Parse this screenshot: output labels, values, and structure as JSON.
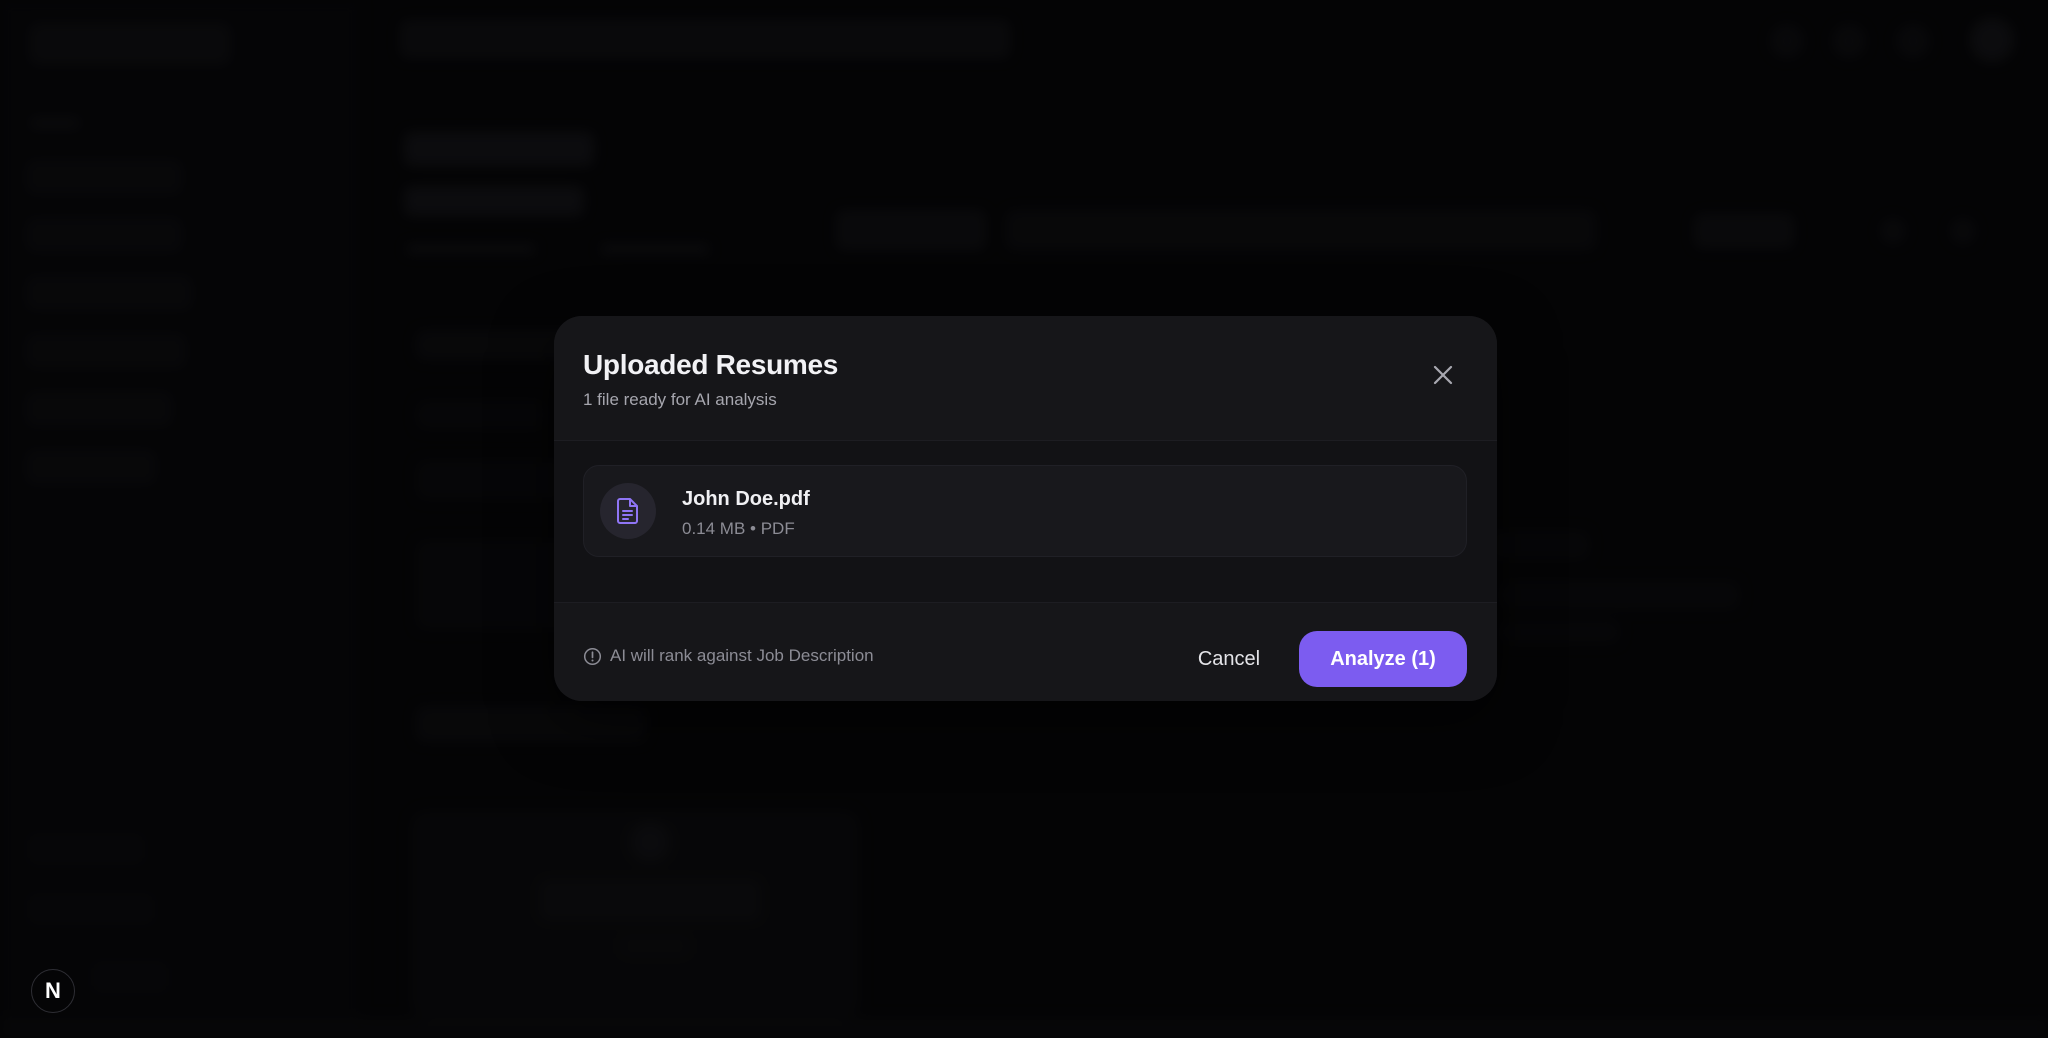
{
  "modal": {
    "title": "Uploaded Resumes",
    "subtitle": "1 file ready for AI analysis",
    "close_icon": "close-icon",
    "files": [
      {
        "name": "John Doe.pdf",
        "meta": "0.14 MB • PDF",
        "icon": "document-icon"
      }
    ],
    "footer_note": "AI will rank against Job Description",
    "footer_icon": "info-circle-icon",
    "cancel_label": "Cancel",
    "analyze_label": "Analyze (1)"
  },
  "badge": {
    "label": "N"
  },
  "colors": {
    "accent": "#7c5cf0",
    "modal_bg": "#161619",
    "file_icon": "#8f75f5"
  }
}
